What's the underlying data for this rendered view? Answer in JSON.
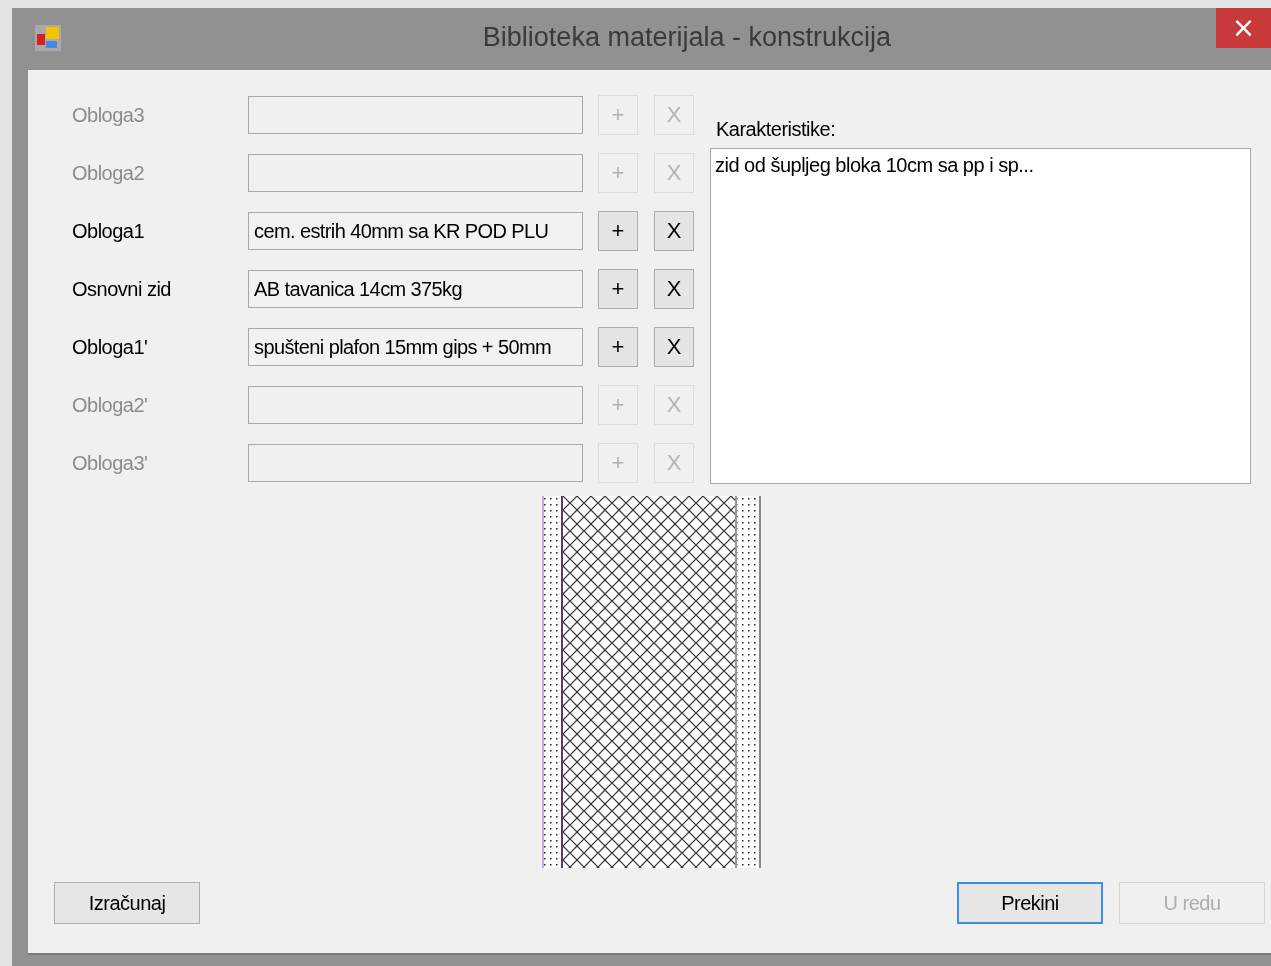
{
  "window": {
    "title": "Biblioteka materijala - konstrukcija",
    "close": "×"
  },
  "layers": [
    {
      "label": "Obloga3",
      "enabled": false,
      "add": "+",
      "remove": "X"
    },
    {
      "label": "Obloga2",
      "enabled": false,
      "add": "+",
      "remove": "X"
    },
    {
      "label": "Obloga1",
      "value": "cem. estrih 40mm sa KR POD PLU",
      "enabled": true,
      "add": "+",
      "remove": "X"
    },
    {
      "label": "Osnovni zid",
      "value": "AB tavanica 14cm 375kg",
      "enabled": true,
      "add": "+",
      "remove": "X"
    },
    {
      "label": "Obloga1'",
      "value": "spušteni plafon 15mm gips + 50mm",
      "enabled": true,
      "add": "+",
      "remove": "X"
    },
    {
      "label": "Obloga2'",
      "enabled": false,
      "add": "+",
      "remove": "X"
    },
    {
      "label": "Obloga3'",
      "enabled": false,
      "add": "+",
      "remove": "X"
    }
  ],
  "characteristics": {
    "label": "Karakteristike:",
    "value": "zid od šupljeg bloka 10cm sa pp i sp..."
  },
  "buttons": [
    {
      "label": "Izračunaj",
      "enabled": true,
      "focused": false
    },
    {
      "label": "Prekini",
      "enabled": true,
      "focused": true
    },
    {
      "label": "U redu",
      "enabled": false,
      "focused": false
    }
  ]
}
